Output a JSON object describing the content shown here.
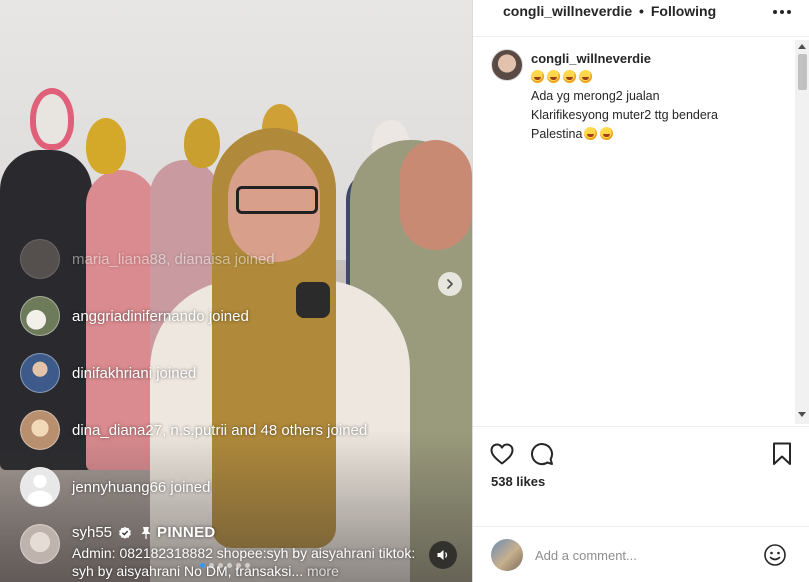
{
  "post": {
    "username": "congli_willneverdie",
    "separator": "•",
    "follow_status": "Following",
    "caption": {
      "username": "congli_willneverdie",
      "lines": [
        "",
        "Ada yg merong2 jualan",
        "Klarifikesyong muter2 ttg bendera",
        "Palestina"
      ]
    },
    "likes": "538 likes",
    "comment_placeholder": "Add a comment..."
  },
  "live": {
    "joins": [
      {
        "text": "maria_liana88, dianaisa joined",
        "avatar_color": "#8b7e74"
      },
      {
        "text": "anggriadinifernando joined",
        "avatar_color": "#6e7b5a"
      },
      {
        "text": "dinifakhriani joined",
        "avatar_color": "#3d5a8a"
      },
      {
        "text": "dina_diana27, n.s.putrii and 48 others joined",
        "avatar_color": "#b89070"
      },
      {
        "text": "jennyhuang66 joined",
        "avatar_color": "#d6d6d6"
      }
    ],
    "pinned": {
      "username": "syh55",
      "label": "PINNED",
      "text": "Admin: 082182318882 shopee:syh by aisyahrani tiktok: syh by aisyahrani No DM, transaksi...",
      "more": "more"
    }
  },
  "colors": {
    "accent": "#3897f0",
    "text": "#262626",
    "muted": "#8e8e8e"
  },
  "icons": {
    "more": "more-horizontal-icon",
    "like": "heart-icon",
    "comment": "comment-bubble-icon",
    "save": "bookmark-icon",
    "emoji": "smiley-icon",
    "next": "chevron-right-icon",
    "volume": "speaker-icon",
    "verified": "verified-badge-icon",
    "pin": "pin-icon"
  }
}
